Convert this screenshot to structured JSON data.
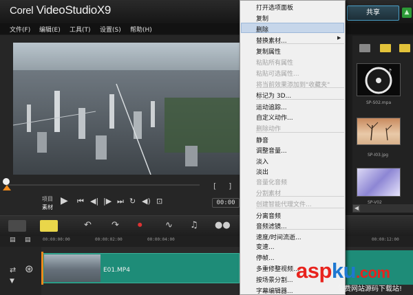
{
  "app": {
    "title_brand": "Corel",
    "title_product": " VideoStudio",
    "title_version": "X9"
  },
  "header": {
    "share_tab": "共享"
  },
  "menubar": [
    {
      "label": "文件(F)"
    },
    {
      "label": "编辑(E)"
    },
    {
      "label": "工具(T)"
    },
    {
      "label": "设置(S)"
    },
    {
      "label": "帮助(H)"
    }
  ],
  "player": {
    "mode_project": "项目",
    "mode_clip": "素材",
    "timecode": "00:00",
    "bracket_in": "[",
    "bracket_out": "]",
    "scrub_position": 0
  },
  "library": {
    "items": [
      {
        "caption": "SP-S02.mpa"
      },
      {
        "caption": "SP-I03.jpg"
      },
      {
        "caption": "SP-V02"
      }
    ]
  },
  "timeline": {
    "ruler": [
      "00:00:00:00",
      "00:00:02:00",
      "00:00:04:00",
      "00:00:12:00"
    ],
    "clip_name": "E01.MP4"
  },
  "context_menu": {
    "items": [
      {
        "label": "打开选项面板",
        "disabled": false
      },
      {
        "label": "复制",
        "disabled": false
      },
      {
        "label": "删除",
        "disabled": false,
        "highlighted": true
      },
      {
        "label": "替换素材...",
        "disabled": false,
        "submenu": true
      },
      {
        "label": "复制属性",
        "disabled": false
      },
      {
        "label": "粘贴所有属性",
        "disabled": true
      },
      {
        "label": "粘贴可选属性...",
        "disabled": true
      },
      {
        "label": "将当前效果添加到\"收藏夹\"",
        "disabled": true
      },
      {
        "label": "标记为 3D...",
        "disabled": false
      },
      {
        "label": "运动追踪...",
        "disabled": false
      },
      {
        "label": "自定义动作...",
        "disabled": false
      },
      {
        "label": "删除动作",
        "disabled": true
      },
      {
        "label": "静音",
        "disabled": false
      },
      {
        "label": "调整音量...",
        "disabled": false
      },
      {
        "label": "淡入",
        "disabled": false
      },
      {
        "label": "淡出",
        "disabled": false
      },
      {
        "label": "音量化音频",
        "disabled": true
      },
      {
        "label": "分割素材",
        "disabled": true
      },
      {
        "label": "创建智能代理文件...",
        "disabled": true
      },
      {
        "label": "分离音频",
        "disabled": false
      },
      {
        "label": "音频滤镜...",
        "disabled": false
      },
      {
        "label": "速度/时间流逝...",
        "disabled": false
      },
      {
        "label": "变速...",
        "disabled": false
      },
      {
        "label": "停帧...",
        "disabled": false
      },
      {
        "label": "多重修整视频...",
        "disabled": false
      },
      {
        "label": "按场景分割...",
        "disabled": false
      },
      {
        "label": "字幕编辑器...",
        "disabled": false
      }
    ]
  },
  "watermark": {
    "brand_a": "asp",
    "brand_b": "ku",
    "brand_c": ".com",
    "subtitle": "免费网站源码下载站!"
  },
  "colors": {
    "accent_blue": "#4aa0c8",
    "clip_green": "#1e8c78",
    "timeline_button_yellow": "#e9d64a",
    "marker_orange": "#f08a1c",
    "menu_highlight": "#c6d6ea"
  }
}
